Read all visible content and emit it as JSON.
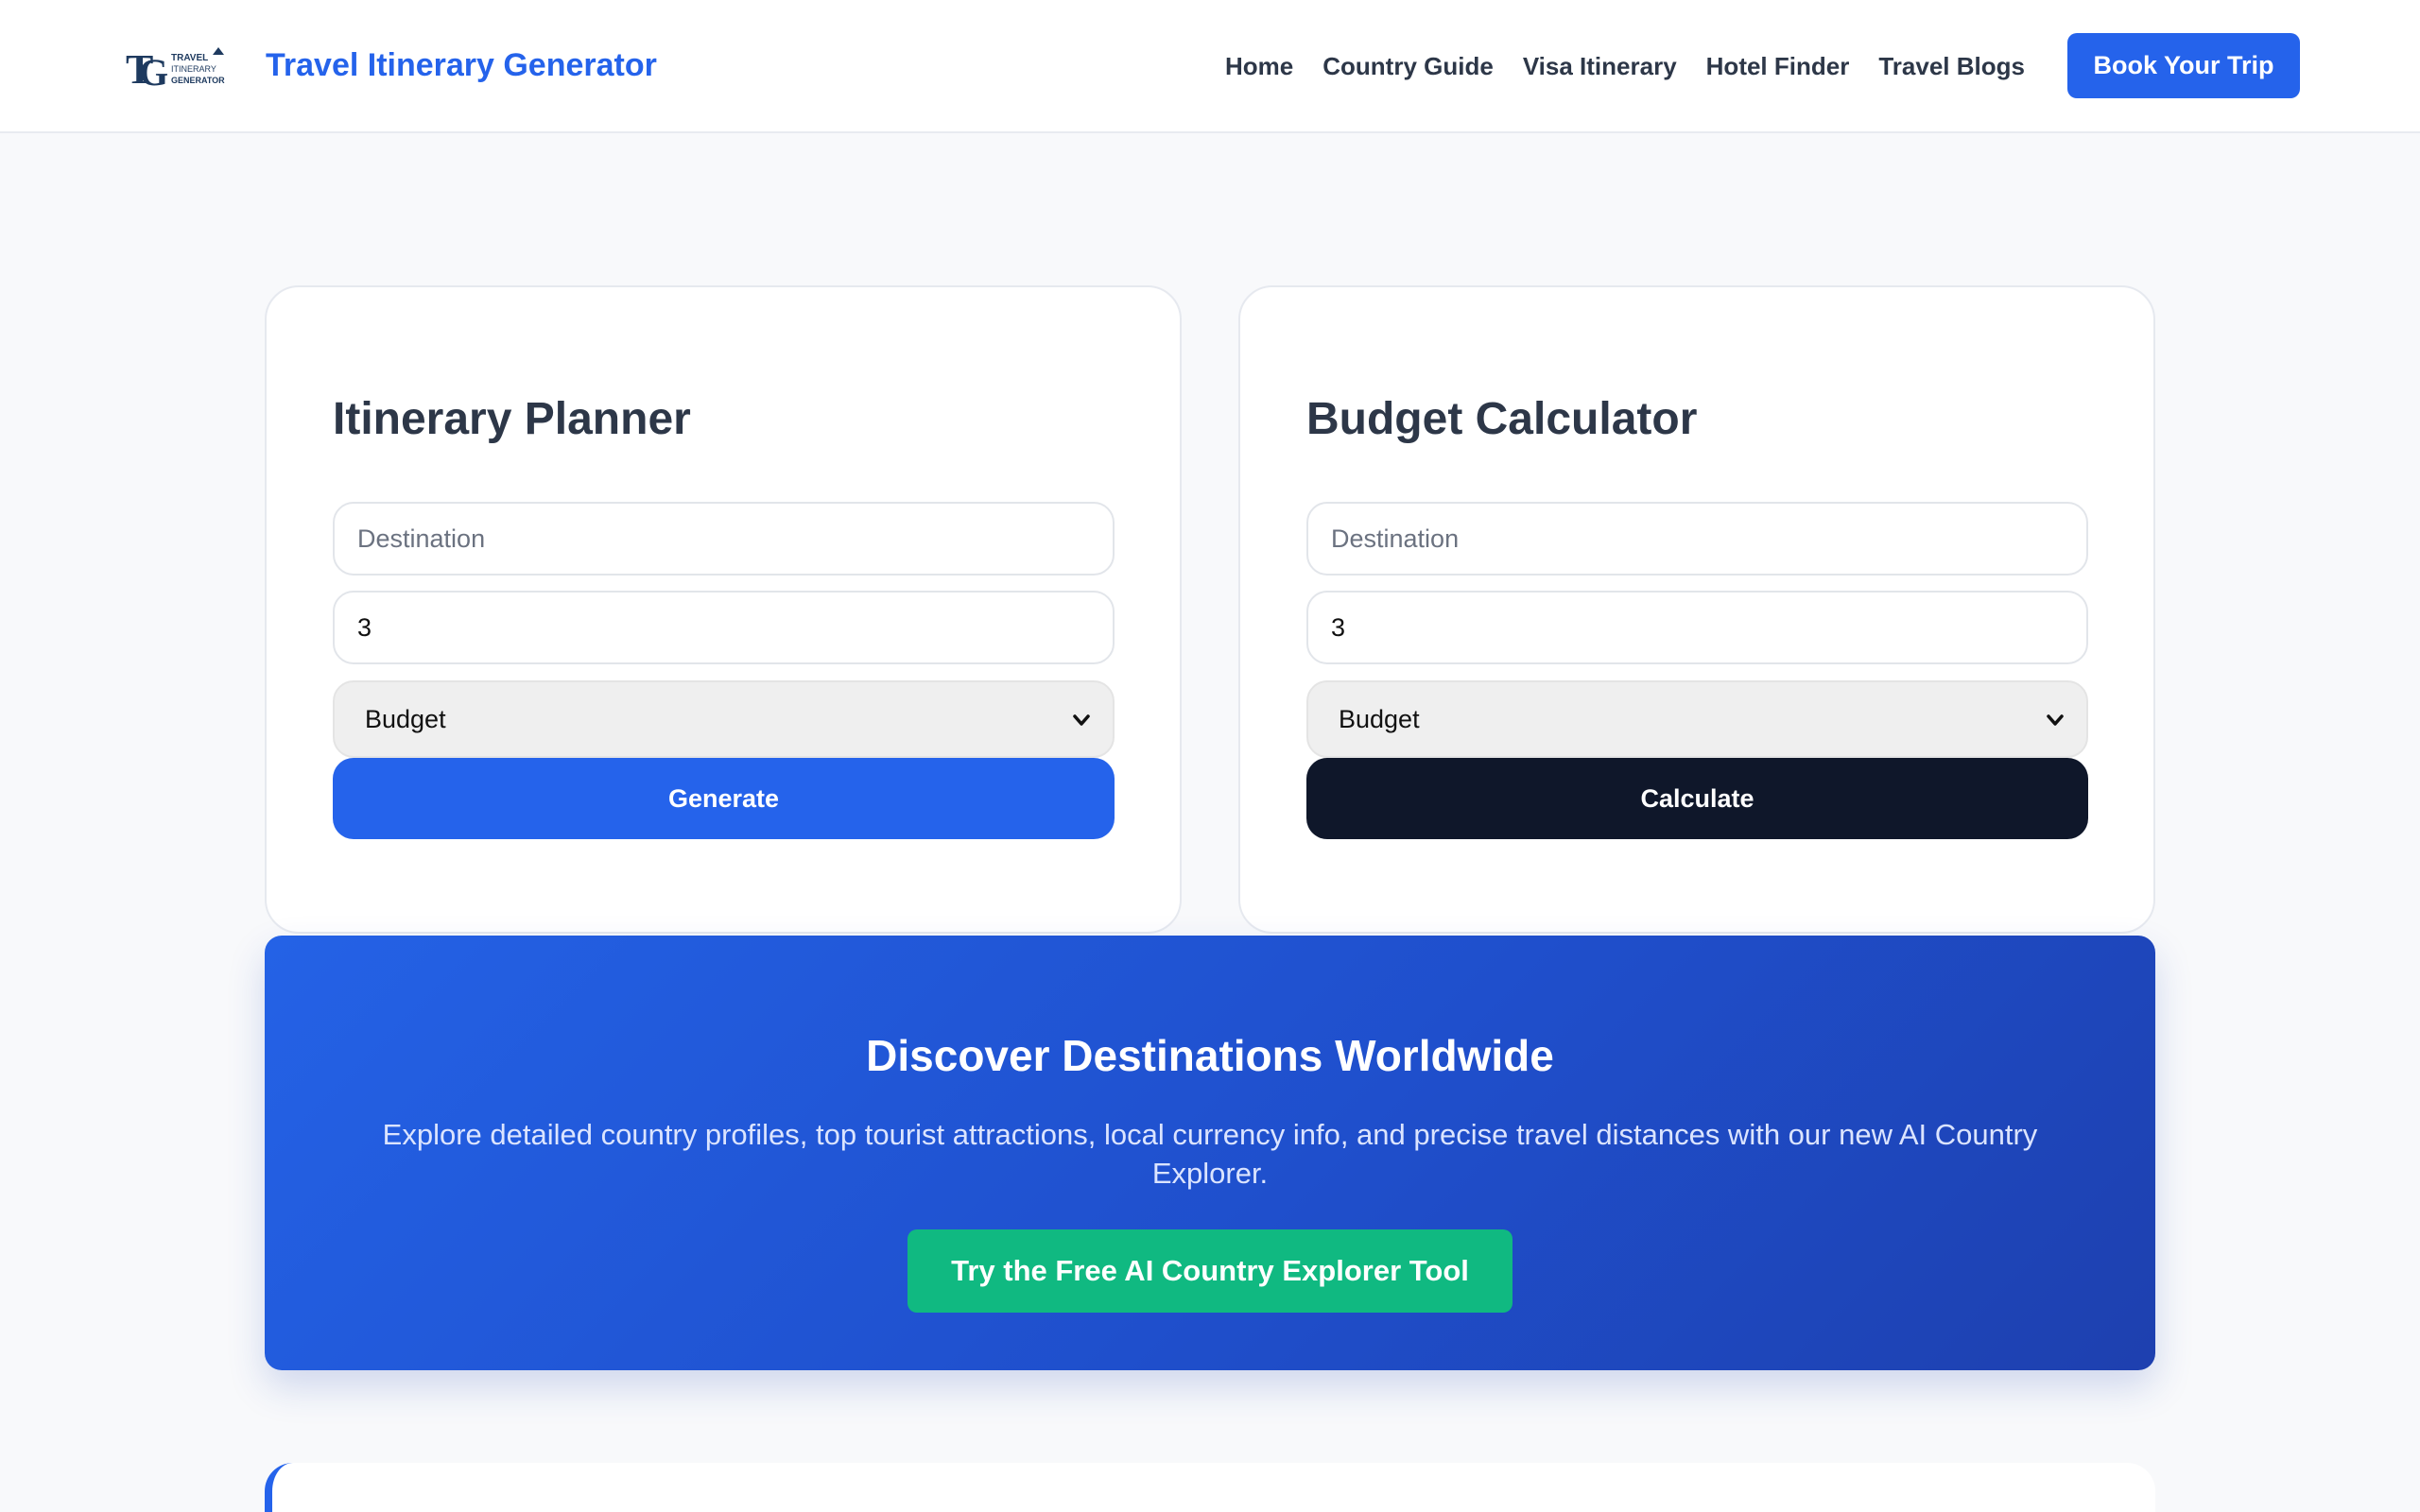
{
  "header": {
    "logo": {
      "lettering": [
        "TRAVEL",
        "ITINERARY",
        "GENERATOR"
      ]
    },
    "brand_title": "Travel Itinerary Generator",
    "nav": [
      "Home",
      "Country Guide",
      "Visa Itinerary",
      "Hotel Finder",
      "Travel Blogs"
    ],
    "cta": "Book Your Trip"
  },
  "planner": {
    "title": "Itinerary Planner",
    "destination_placeholder": "Destination",
    "days_value": "3",
    "budget_selected": "Budget",
    "button": "Generate"
  },
  "calculator": {
    "title": "Budget Calculator",
    "destination_placeholder": "Destination",
    "days_value": "3",
    "budget_selected": "Budget",
    "button": "Calculate"
  },
  "banner": {
    "title": "Discover Destinations Worldwide",
    "description": "Explore detailed country profiles, top tourist attractions, local currency info, and precise travel distances with our new AI Country Explorer.",
    "button": "Try the Free AI Country Explorer Tool"
  },
  "colors": {
    "accent": "#2563eb",
    "dark": "#0f172a",
    "success": "#10b981"
  },
  "icons": {
    "select_chevron": "chevron-down-icon"
  }
}
